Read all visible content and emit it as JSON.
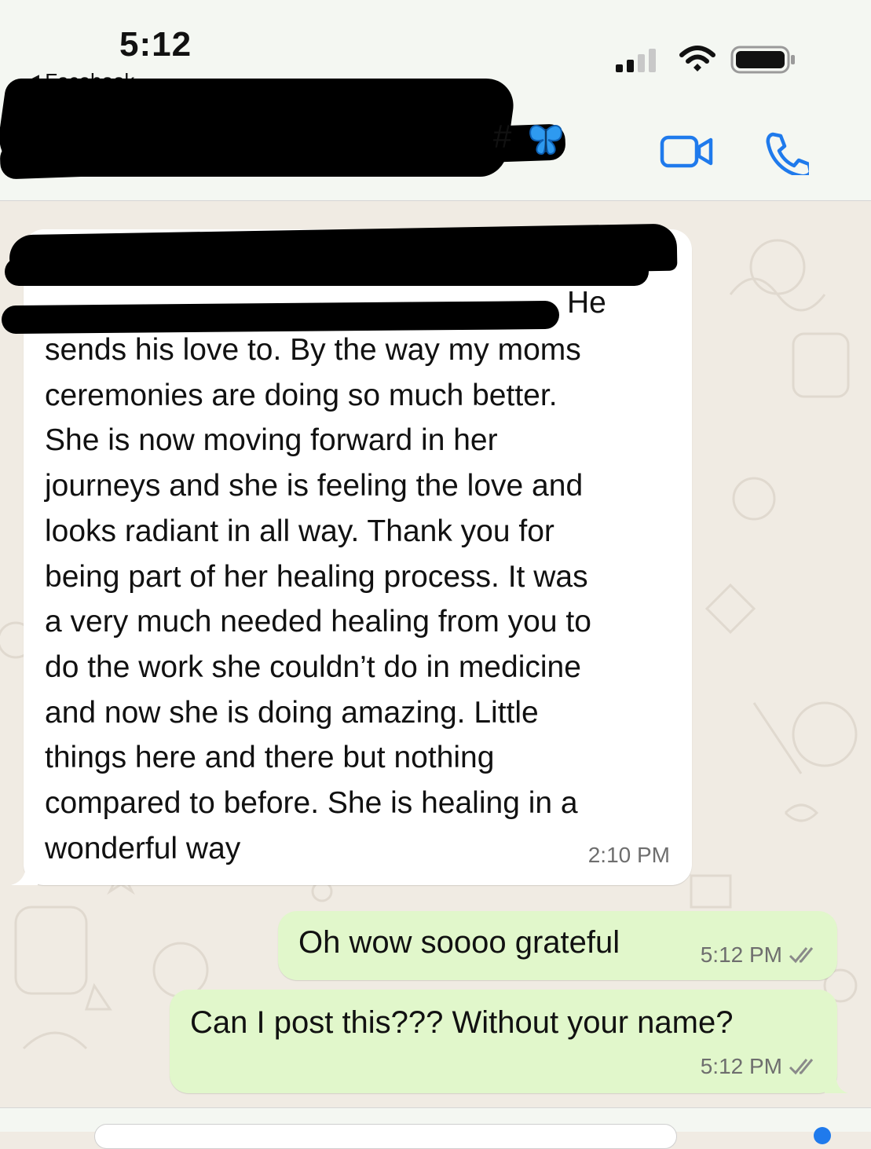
{
  "status_bar": {
    "time": "5:12",
    "back_label": "Facebook"
  },
  "chat_header": {
    "contact_name_visible_suffix": "#",
    "contact_emoji_icon": "butterfly-emoji",
    "video_call_icon": "video-camera-icon",
    "voice_call_icon": "phone-icon"
  },
  "messages": [
    {
      "direction": "incoming",
      "text_visible_start": "He",
      "text": "sends his love to. By the way my moms\nceremonies are doing so much better.\nShe is now moving forward in her\njourneys and she is feeling the love and\nlooks radiant in all way. Thank you for\nbeing part of her healing process. It was\na very much needed healing from you to\ndo the work she couldn’t do in medicine\nand now she is doing amazing. Little\nthings here and there but nothing\ncompared to before. She is healing in a\nwonderful way",
      "time": "2:10 PM"
    },
    {
      "direction": "outgoing",
      "text": "Oh wow soooo grateful",
      "time": "5:12 PM",
      "status": "read"
    },
    {
      "direction": "outgoing",
      "text": "Can I post this??? Without your name?",
      "time": "5:12 PM",
      "status": "read"
    }
  ],
  "colors": {
    "incoming_bubble": "#ffffff",
    "outgoing_bubble": "#e1f7cb",
    "read_ticks": "#8a8a8a",
    "accent_blue": "#1f7aec"
  }
}
